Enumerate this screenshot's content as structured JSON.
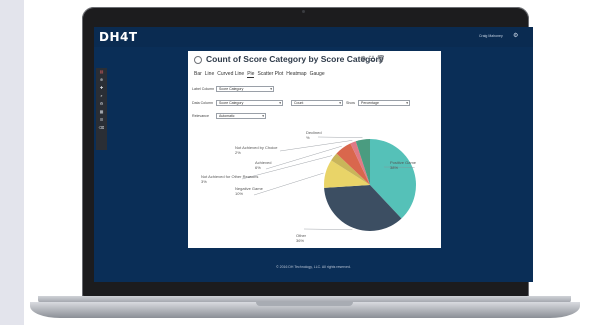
{
  "app": {
    "logo": "DH4T",
    "user_name": "Craig Mahoney",
    "footer": "© 2016 DH Technology, LLC. All rights reserved."
  },
  "nav_icons": [
    {
      "name": "chart-icon",
      "glyph": "▤",
      "color": "#e06060"
    },
    {
      "name": "globe-icon",
      "glyph": "⊕"
    },
    {
      "name": "plus-icon",
      "glyph": "✚"
    },
    {
      "name": "search-icon",
      "glyph": "⌕"
    },
    {
      "name": "settings-icon",
      "glyph": "⚙"
    },
    {
      "name": "grid-icon",
      "glyph": "▦"
    },
    {
      "name": "list-icon",
      "glyph": "☰"
    },
    {
      "name": "trash-icon",
      "glyph": "⌫"
    }
  ],
  "panel": {
    "title": "Count of Score Category by Score Category",
    "tabs": [
      "Bar",
      "Line",
      "Curved Line",
      "Pie",
      "Scatter Plot",
      "Heatmap",
      "Gauge"
    ],
    "active_tab": "Pie",
    "fields": {
      "label_column_label": "Label Column",
      "label_column_value": "Score Category",
      "data_column_label": "Data Column",
      "data_column_value": "Score Category",
      "aggregate_value": "Count",
      "show_label": "Show",
      "show_value": "Percentage",
      "relevance_label": "Relevance",
      "relevance_value": "Automatic"
    }
  },
  "chart_data": {
    "type": "pie",
    "title": "",
    "slices": [
      {
        "name": "Positive Game",
        "value": 38,
        "label": "Positive Game",
        "pct_label": "38%",
        "color": "#55c1b8"
      },
      {
        "name": "Other",
        "value": 36,
        "label": "Other",
        "pct_label": "36%",
        "color": "#3c4e62"
      },
      {
        "name": "Negative Game",
        "value": 10,
        "label": "Negative Game",
        "pct_label": "10%",
        "color": "#e9d468"
      },
      {
        "name": "Not Achieved for Other Reasons",
        "value": 3,
        "label": "Not Achieved for Other Reasons",
        "pct_label": "3%",
        "color": "#c9b55a"
      },
      {
        "name": "Achieved",
        "value": 6,
        "label": "Achieved",
        "pct_label": "6%",
        "color": "#d9674d"
      },
      {
        "name": "Not Achieved by Choice",
        "value": 2,
        "label": "Not Achieved by Choice",
        "pct_label": "2%",
        "color": "#e07a86"
      },
      {
        "name": "Declined",
        "value": 5,
        "label": "Declined",
        "pct_label": "%",
        "color": "#4a9c80"
      }
    ],
    "extra_slice_color": "#3a3a6a"
  }
}
